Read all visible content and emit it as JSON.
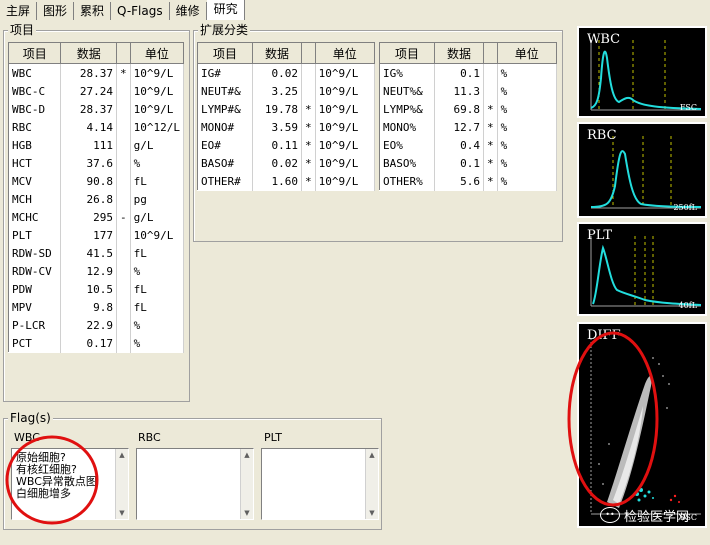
{
  "tabs": [
    "主屏",
    "图形",
    "累积",
    "Q-Flags",
    "维修",
    "研究"
  ],
  "items_group": {
    "title": "项目",
    "headers": [
      "项目",
      "数据",
      "",
      "单位"
    ],
    "rows": [
      [
        "WBC",
        "28.37",
        "*",
        "10^9/L"
      ],
      [
        "WBC-C",
        "27.24",
        "",
        "10^9/L"
      ],
      [
        "WBC-D",
        "28.37",
        "",
        "10^9/L"
      ],
      [
        "RBC",
        "4.14",
        "",
        "10^12/L"
      ],
      [
        "HGB",
        "111",
        "",
        "g/L"
      ],
      [
        "HCT",
        "37.6",
        "",
        "%"
      ],
      [
        "MCV",
        "90.8",
        "",
        "fL"
      ],
      [
        "MCH",
        "26.8",
        "",
        "pg"
      ],
      [
        "MCHC",
        "295",
        "-",
        "g/L"
      ],
      [
        "PLT",
        "177",
        "",
        "10^9/L"
      ],
      [
        "RDW-SD",
        "41.5",
        "",
        "fL"
      ],
      [
        "RDW-CV",
        "12.9",
        "",
        "%"
      ],
      [
        "PDW",
        "10.5",
        "",
        "fL"
      ],
      [
        "MPV",
        "9.8",
        "",
        "fL"
      ],
      [
        "P-LCR",
        "22.9",
        "",
        "%"
      ],
      [
        "PCT",
        "0.17",
        "",
        "%"
      ]
    ]
  },
  "ext_group": {
    "title": "扩展分类",
    "headers": [
      "项目",
      "数据",
      "",
      "单位"
    ],
    "left_rows": [
      [
        "IG#",
        "0.02",
        "",
        "10^9/L"
      ],
      [
        "NEUT#&",
        "3.25",
        "",
        "10^9/L"
      ],
      [
        "LYMP#&",
        "19.78",
        "*",
        "10^9/L"
      ],
      [
        "MONO#",
        "3.59",
        "*",
        "10^9/L"
      ],
      [
        "EO#",
        "0.11",
        "*",
        "10^9/L"
      ],
      [
        "BASO#",
        "0.02",
        "*",
        "10^9/L"
      ],
      [
        "OTHER#",
        "1.60",
        "*",
        "10^9/L"
      ]
    ],
    "right_rows": [
      [
        "IG%",
        "0.1",
        "",
        "%"
      ],
      [
        "NEUT%&",
        "11.3",
        "",
        "%"
      ],
      [
        "LYMP%&",
        "69.8",
        "*",
        "%"
      ],
      [
        "MONO%",
        "12.7",
        "*",
        "%"
      ],
      [
        "EO%",
        "0.4",
        "*",
        "%"
      ],
      [
        "BASO%",
        "0.1",
        "*",
        "%"
      ],
      [
        "OTHER%",
        "5.6",
        "*",
        "%"
      ]
    ]
  },
  "flags": {
    "title": "Flag(s)",
    "wbc_label": "WBC",
    "rbc_label": "RBC",
    "plt_label": "PLT",
    "wbc_messages": [
      "原始细胞?",
      "有核红细胞?",
      "WBC异常散点图",
      "白细胞增多"
    ]
  },
  "histograms": {
    "wbc": {
      "label": "WBC",
      "unit": "FSC"
    },
    "rbc": {
      "label": "RBC",
      "unit": "250fL"
    },
    "plt": {
      "label": "PLT",
      "unit": "40fL"
    },
    "diff": {
      "label": "DIFF",
      "unit": "SSC"
    }
  },
  "watermark": {
    "text": "检验医学网",
    "icon": "wechat-icon"
  },
  "colors": {
    "curve": "#22dddd",
    "marker": "#c0c000",
    "diff_red": "#ff2020",
    "annotation": "#e01010"
  }
}
